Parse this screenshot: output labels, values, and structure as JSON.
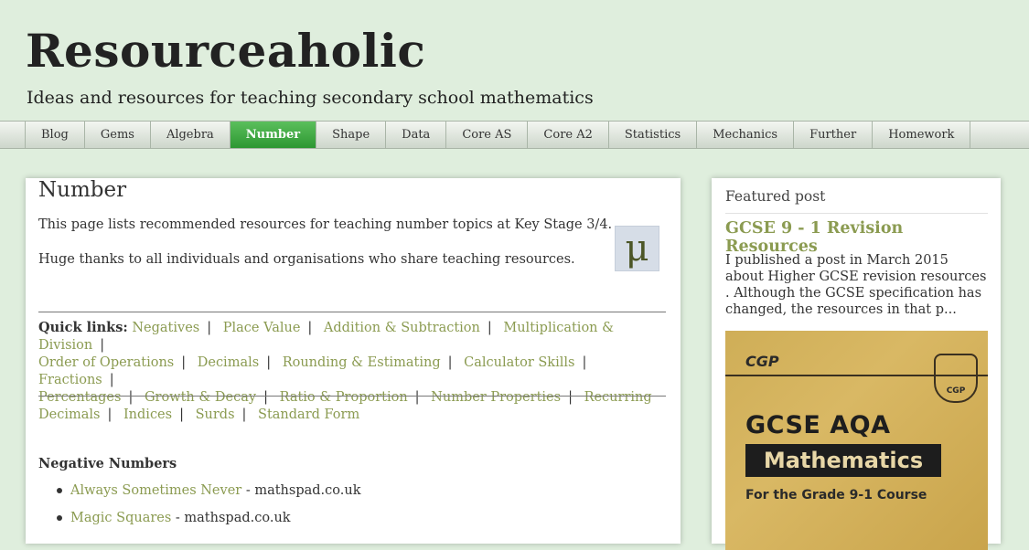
{
  "site": {
    "title": "Resourceaholic",
    "description": "Ideas and resources for teaching secondary school mathematics"
  },
  "nav": {
    "tabs": [
      "Blog",
      "Gems",
      "Algebra",
      "Number",
      "Shape",
      "Data",
      "Core AS",
      "Core A2",
      "Statistics",
      "Mechanics",
      "Further",
      "Homework"
    ],
    "active": "Number",
    "active_color": "#3aa53e"
  },
  "main": {
    "title": "Number",
    "intro": "This page lists recommended resources for teaching number topics at Key Stage 3/4.",
    "thanks": "Huge thanks to all individuals and organisations who share teaching resources.",
    "mu_symbol": "μ",
    "quick_links_label": "Quick links:",
    "quick_links": [
      "Negatives",
      "Place Value",
      "Addition & Subtraction",
      "Multiplication & Division",
      "Order of Operations",
      "Decimals",
      "Rounding & Estimating",
      "Calculator Skills",
      "Fractions",
      "Percentages",
      "Growth & Decay",
      "Ratio & Proportion",
      "Number Properties",
      "Recurring Decimals",
      "Indices",
      "Surds",
      "Standard Form"
    ],
    "section_heading": "Negative Numbers",
    "resources": [
      {
        "name": "Always Sometimes Never",
        "source": " - mathspad.co.uk"
      },
      {
        "name": "Magic Squares",
        "source": " - mathspad.co.uk"
      }
    ],
    "link_color": "#8b9b51"
  },
  "sidebar": {
    "heading": "Featured post",
    "post_title": "GCSE 9 - 1 Revision Resources",
    "post_excerpt": "I published a post in March 2015 about Higher GCSE revision resources . Although the GCSE specification has changed, the resources in that p...",
    "book": {
      "brand": "CGP",
      "crest_label": "CGP",
      "line1": "GCSE AQA",
      "line2": "Mathematics",
      "line3": "For the Grade 9-1 Course"
    }
  }
}
